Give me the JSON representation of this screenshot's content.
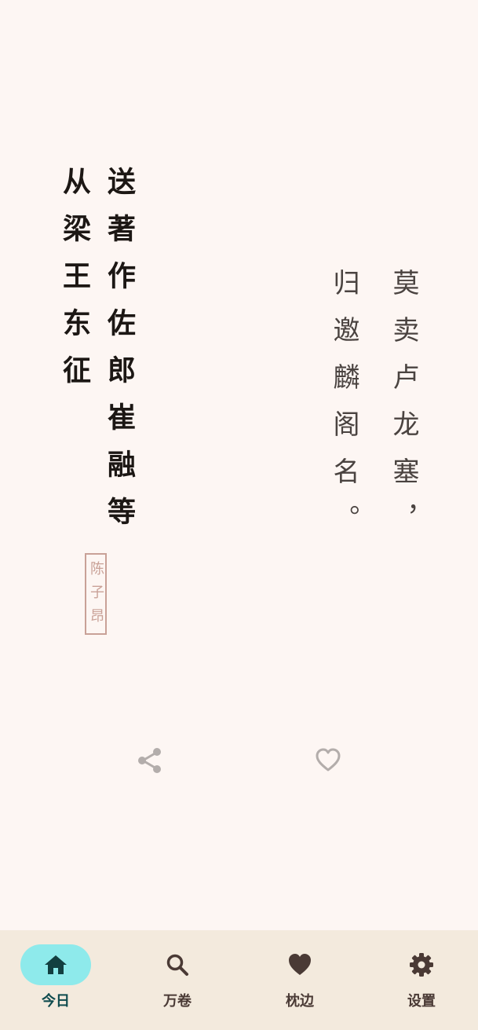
{
  "poem": {
    "title_line_1": "送著作佐郎崔融等",
    "title_line_2": "从梁王东征",
    "author": "陈子昂",
    "verse_line_1": "莫卖卢龙塞，",
    "verse_line_2": "归邀麟阁名。"
  },
  "actions": {
    "share_icon": "share-icon",
    "favorite_icon": "heart-outline-icon"
  },
  "nav": {
    "items": [
      {
        "label": "今日",
        "icon": "home-icon",
        "active": true
      },
      {
        "label": "万卷",
        "icon": "search-icon",
        "active": false
      },
      {
        "label": "枕边",
        "icon": "heart-icon",
        "active": false
      },
      {
        "label": "设置",
        "icon": "gear-icon",
        "active": false
      }
    ]
  },
  "colors": {
    "background": "#fdf6f3",
    "nav_background": "#f3eadd",
    "active_pill": "#8eeaeb",
    "author_seal": "#c9a197",
    "title_text": "#1c1714",
    "verse_text": "#4a4340"
  }
}
